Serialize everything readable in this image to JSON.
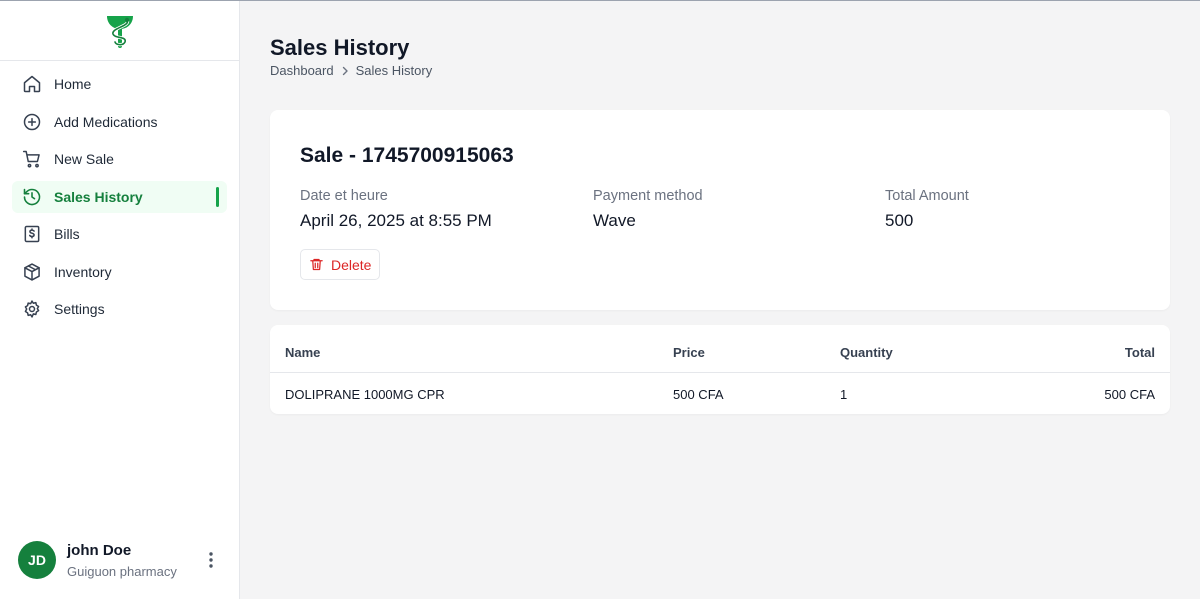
{
  "sidebar": {
    "items": [
      {
        "label": "Home",
        "icon": "home-icon"
      },
      {
        "label": "Add Medications",
        "icon": "plus-circle-icon"
      },
      {
        "label": "New Sale",
        "icon": "cart-icon"
      },
      {
        "label": "Sales History",
        "icon": "history-icon",
        "active": true
      },
      {
        "label": "Bills",
        "icon": "dollar-receipt-icon"
      },
      {
        "label": "Inventory",
        "icon": "box-icon"
      },
      {
        "label": "Settings",
        "icon": "gear-icon"
      }
    ]
  },
  "user": {
    "initials": "JD",
    "name": "john Doe",
    "organization": "Guiguon pharmacy"
  },
  "page": {
    "title": "Sales History",
    "breadcrumb": [
      "Dashboard",
      "Sales History"
    ]
  },
  "sale": {
    "title": "Sale - 1745700915063",
    "date_label": "Date et heure",
    "date_value": "April 26, 2025 at 8:55 PM",
    "payment_label": "Payment method",
    "payment_value": "Wave",
    "total_label": "Total Amount",
    "total_value": "500",
    "delete_label": "Delete"
  },
  "table": {
    "headers": [
      "Name",
      "Price",
      "Quantity",
      "Total"
    ],
    "rows": [
      [
        "DOLIPRANE 1000MG CPR",
        "500 CFA",
        "1",
        "500 CFA"
      ]
    ]
  },
  "colors": {
    "accent": "#15803d",
    "active_bg": "#f0fdf4",
    "danger": "#dc2626",
    "background": "#f4f4f5"
  }
}
